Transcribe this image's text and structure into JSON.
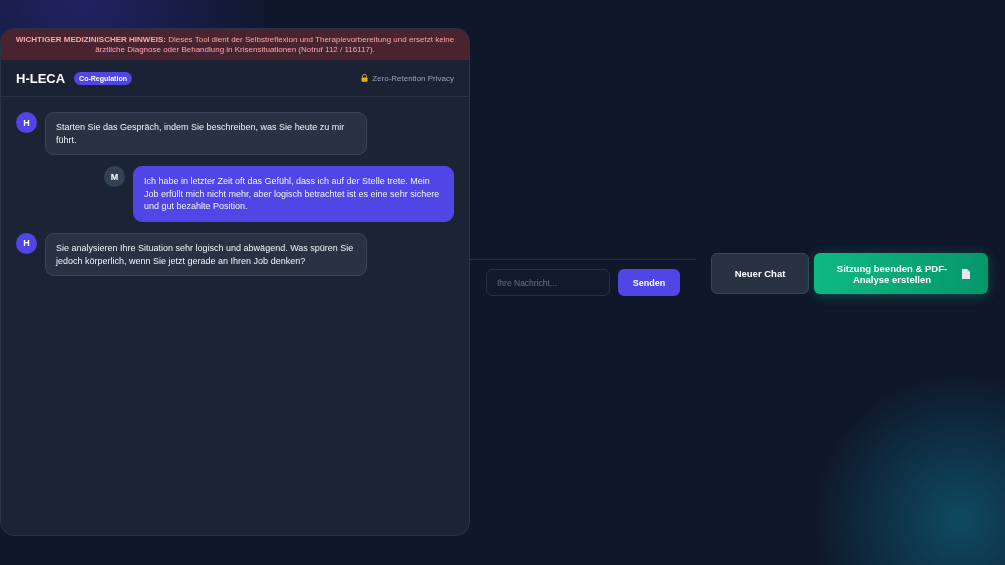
{
  "notice": "**WICHTIGER MEDIZINISCHER HINWEIS:** Dieses Tool dient der Selbstreflexion und Therapievorbereitung und ersetzt keine ärztliche Diagnose oder Behandlung in Krisensituationen (Notruf 112 / 116117).",
  "header": {
    "title": "H-LECA",
    "badge": "Co-Regulation",
    "privacy": "Zero-Retention Privacy"
  },
  "messages": [
    {
      "kind": "assistant",
      "avatar": "H",
      "text": "Starten Sie das Gespräch, indem Sie beschreiben, was Sie heute zu mir führt."
    },
    {
      "kind": "user",
      "avatar": "M",
      "text": "Ich habe in letzter Zeit oft das Gefühl, dass ich auf der Stelle trete. Mein Job erfüllt mich nicht mehr, aber logisch betrachtet ist es eine sehr sichere und gut bezahlte Position."
    },
    {
      "kind": "assistant",
      "avatar": "H",
      "text": "Sie analysieren Ihre Situation sehr logisch und abwägend. Was spüren Sie jedoch körperlich, wenn Sie jetzt gerade an Ihren Job denken?"
    }
  ],
  "composer": {
    "placeholder": "Ihre Nachricht...",
    "send": "Senden"
  },
  "actions": {
    "new_chat": "Neuer Chat",
    "end_session": "Sitzung beenden & PDF-Analyse erstellen"
  }
}
